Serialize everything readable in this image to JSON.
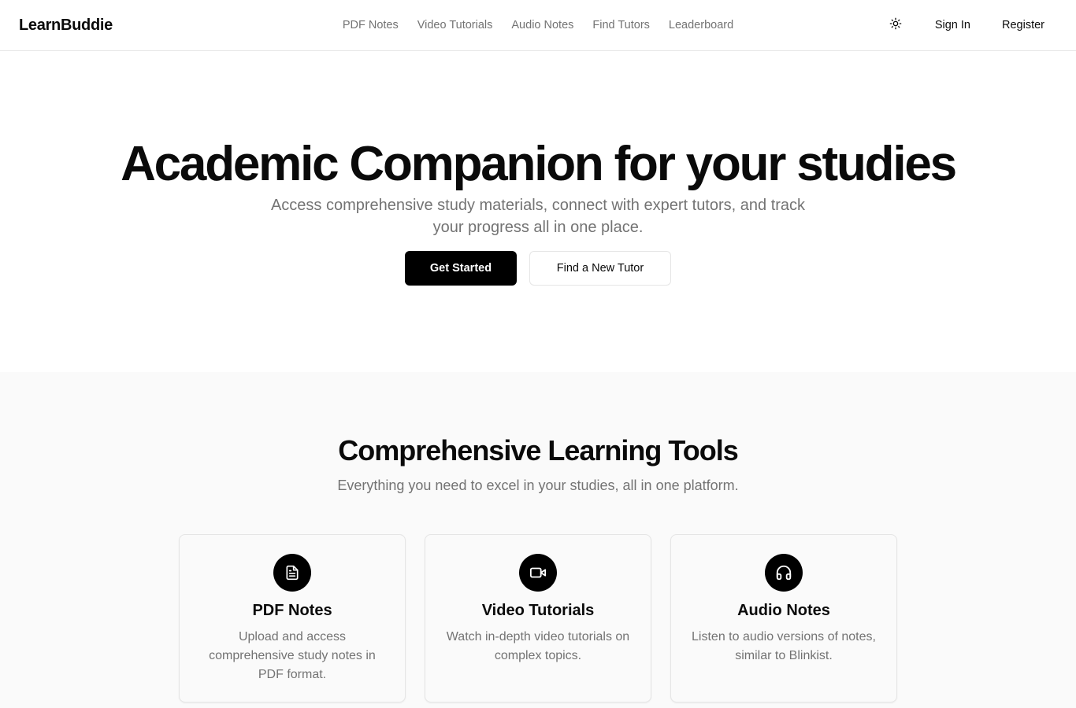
{
  "header": {
    "logo": "LearnBuddie",
    "nav": [
      "PDF Notes",
      "Video Tutorials",
      "Audio Notes",
      "Find Tutors",
      "Leaderboard"
    ],
    "theme_toggle_icon": "sun-icon",
    "sign_in": "Sign In",
    "register": "Register"
  },
  "hero": {
    "title": "Academic Companion for your studies",
    "subtitle": "Access comprehensive study materials, connect with expert tutors, and track your progress all in one place.",
    "primary_button": "Get Started",
    "secondary_button": "Find a New Tutor"
  },
  "features": {
    "title": "Comprehensive Learning Tools",
    "subtitle": "Everything you need to excel in your studies, all in one platform.",
    "cards": [
      {
        "icon": "file-text-icon",
        "title": "PDF Notes",
        "description": "Upload and access comprehensive study notes in PDF format."
      },
      {
        "icon": "video-camera-icon",
        "title": "Video Tutorials",
        "description": "Watch in-depth video tutorials on complex topics."
      },
      {
        "icon": "headphones-icon",
        "title": "Audio Notes",
        "description": "Listen to audio versions of notes, similar to Blinkist."
      }
    ]
  },
  "colors": {
    "text": "#0a0a0a",
    "muted": "#737373",
    "border": "#e5e5e5",
    "section_bg": "#fafafa",
    "primary": "#000000"
  }
}
